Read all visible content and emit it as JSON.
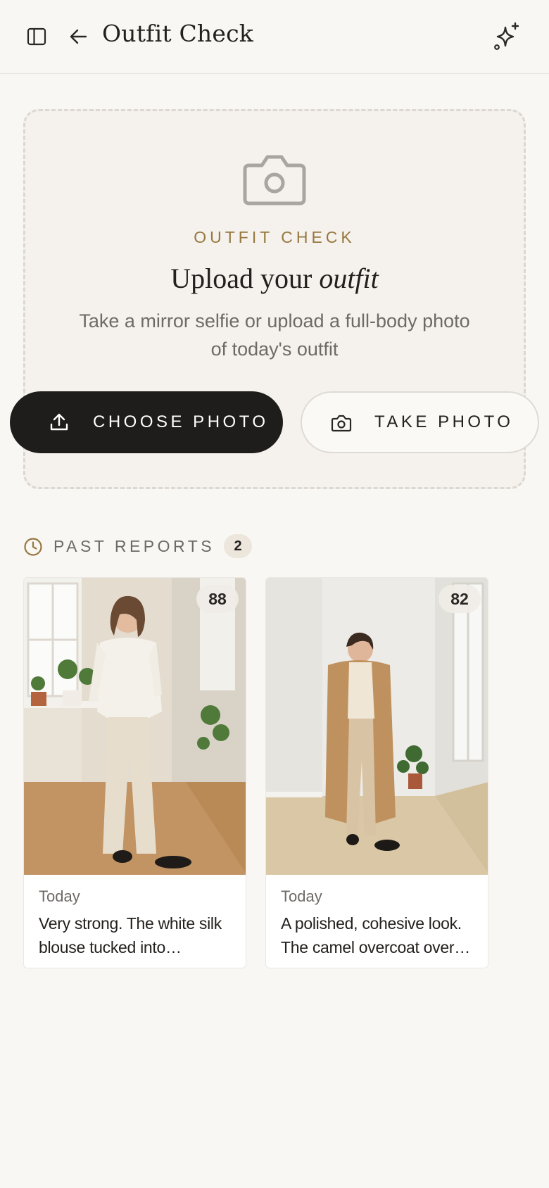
{
  "header": {
    "title": "Outfit Check",
    "icons": {
      "sidebar": "sidebar-toggle-icon",
      "back": "arrow-left-icon",
      "sparkle": "sparkles-icon"
    }
  },
  "upload": {
    "eyebrow": "OUTFIT CHECK",
    "headline_main": "Upload your ",
    "headline_em": "outfit",
    "subtext": "Take a mirror selfie or upload a full-body photo of today's outfit",
    "choose_label": "CHOOSE PHOTO",
    "take_label": "TAKE PHOTO",
    "icons": {
      "camera": "camera-icon",
      "upload": "upload-icon"
    }
  },
  "reports": {
    "label": "PAST REPORTS",
    "count": "2",
    "items": [
      {
        "score": "88",
        "date": "Today",
        "summary": "Very strong. The white silk blouse tucked into…",
        "photo": "woman in white silk blouse and cream trousers by window"
      },
      {
        "score": "82",
        "date": "Today",
        "summary": "A polished, cohesive look. The camel overcoat over…",
        "photo": "woman in camel overcoat with cream knit and trousers"
      }
    ]
  },
  "colors": {
    "background": "#f9f7f4",
    "accent_gold": "#96783f",
    "button_dark": "#1f1d1b",
    "upload_bg": "#f5f1ec"
  }
}
